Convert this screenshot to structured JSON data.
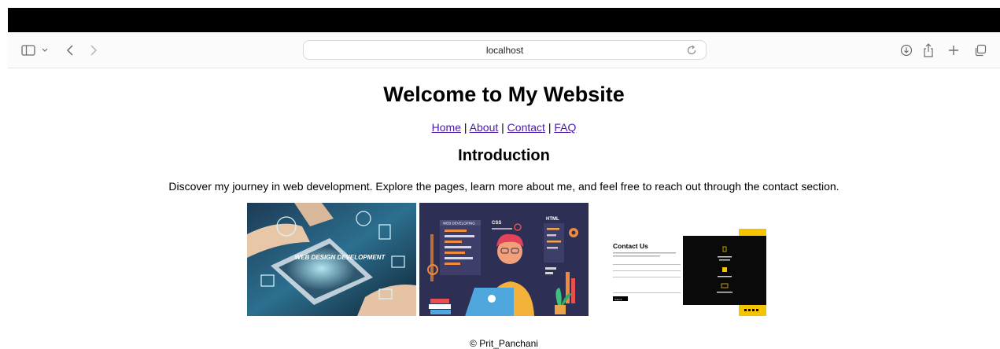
{
  "browser": {
    "url": "localhost",
    "icons": {
      "sidebar": "sidebar-icon",
      "sidebar_chevron": "chevron-down-icon",
      "back": "back-icon",
      "forward": "forward-icon",
      "reload": "reload-icon",
      "download": "download-icon",
      "share": "share-icon",
      "new_tab": "plus-icon",
      "tabs": "tabs-overview-icon"
    }
  },
  "page": {
    "title": "Welcome to My Website",
    "nav": {
      "home": "Home",
      "about": "About",
      "contact": "Contact",
      "faq": "FAQ",
      "separator": "|"
    },
    "section_title": "Introduction",
    "intro": "Discover my journey in web development. Explore the pages, learn more about me, and feel free to reach out through the contact section.",
    "images": {
      "img1_text": "WEB DESIGN DEVELOPMENT",
      "img2_labels": {
        "web_developing": "WEB DEVELOPING",
        "css": "CSS",
        "html": "HTML"
      },
      "img3": {
        "heading": "Contact Us",
        "button": "Submit"
      }
    },
    "footer": "© Prit_Panchani"
  },
  "colors": {
    "link": "#4a1aa6",
    "contact_accent": "#f5c400"
  }
}
